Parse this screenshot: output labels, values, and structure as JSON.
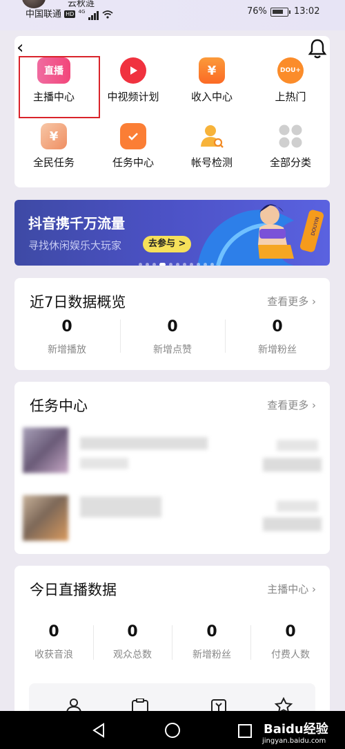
{
  "status_bar": {
    "carrier": "中国联通",
    "hd": "HD",
    "network": "4G",
    "battery": "76%",
    "time": "13:02",
    "partial_name": "云秋涟"
  },
  "grid": [
    {
      "label": "主播中心",
      "icon": "live-icon",
      "color": "#f2467a"
    },
    {
      "label": "中视频计划",
      "icon": "play-icon",
      "color": "#f0323f"
    },
    {
      "label": "收入中心",
      "icon": "yen-icon",
      "color": "#fb7b2a"
    },
    {
      "label": "上热门",
      "icon": "dou-icon",
      "color": "#fb8c2a"
    },
    {
      "label": "全民任务",
      "icon": "yen-card-icon",
      "color": "#f0a173"
    },
    {
      "label": "任务中心",
      "icon": "calendar-check-icon",
      "color": "#fb7e35"
    },
    {
      "label": "帐号检测",
      "icon": "user-search-icon",
      "color": "#f7b33a"
    },
    {
      "label": "全部分类",
      "icon": "grid-icon",
      "color": "#c9c9c9"
    }
  ],
  "icon_text": {
    "live": "直播",
    "yen": "¥",
    "dou": "DOU+"
  },
  "banner": {
    "title": "抖音携千万流量",
    "subtitle": "寻找休闲娱乐大玩家",
    "cta": "去参与 >",
    "poster": "DOUYIN"
  },
  "data7": {
    "title": "近7日数据概览",
    "more": "查看更多",
    "stats": [
      {
        "value": "0",
        "label": "新增播放"
      },
      {
        "value": "0",
        "label": "新增点赞"
      },
      {
        "value": "0",
        "label": "新增粉丝"
      }
    ]
  },
  "tasks": {
    "title": "任务中心",
    "more": "查看更多"
  },
  "live": {
    "title": "今日直播数据",
    "more": "主播中心",
    "stats": [
      {
        "value": "0",
        "label": "收获音浪"
      },
      {
        "value": "0",
        "label": "观众总数"
      },
      {
        "value": "0",
        "label": "新增粉丝"
      },
      {
        "value": "0",
        "label": "付费人数"
      }
    ]
  },
  "watermark": {
    "brand": "Baidu经验",
    "url": "jingyan.baidu.com"
  }
}
